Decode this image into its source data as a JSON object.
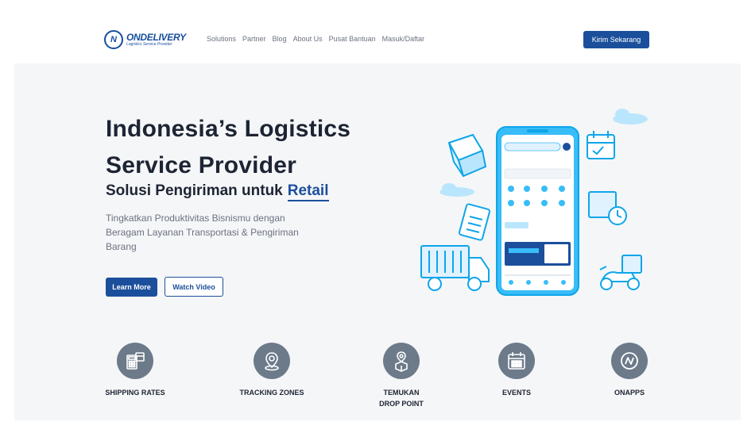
{
  "nav": {
    "logo_name": "ONDELIVERY",
    "logo_tagline": "Logistics Service Provider",
    "menu": [
      "Solutions",
      "Partner",
      "Blog",
      "About Us",
      "Pusat Bantuan",
      "Masuk/Daftar"
    ],
    "cta": "Kirim Sekarang"
  },
  "hero": {
    "title": "Indonesia’s Logistics Service Provider",
    "subtitle_prefix": "Solusi Pengiriman untuk",
    "subtitle_highlight": "Retail",
    "description": "Tingkatkan Produktivitas Bisnismu dengan Beragam Layanan Transportasi & Pengiriman Barang",
    "primary_button": "Learn More",
    "secondary_button": "Watch Video"
  },
  "features": [
    {
      "label": "SHIPPING RATES",
      "icon": "calculator-icon"
    },
    {
      "label": "TRACKING ZONES",
      "icon": "location-pin-icon"
    },
    {
      "label": "TEMUKAN\nDROP POINT",
      "icon": "drop-point-icon"
    },
    {
      "label": "EVENTS",
      "icon": "calendar-icon"
    },
    {
      "label": "ONAPPS",
      "icon": "onapps-logo-icon"
    }
  ],
  "colors": {
    "brand": "#1b4f9c",
    "icon_bg": "#6c7a8a",
    "illustration": "#38bdf8"
  }
}
